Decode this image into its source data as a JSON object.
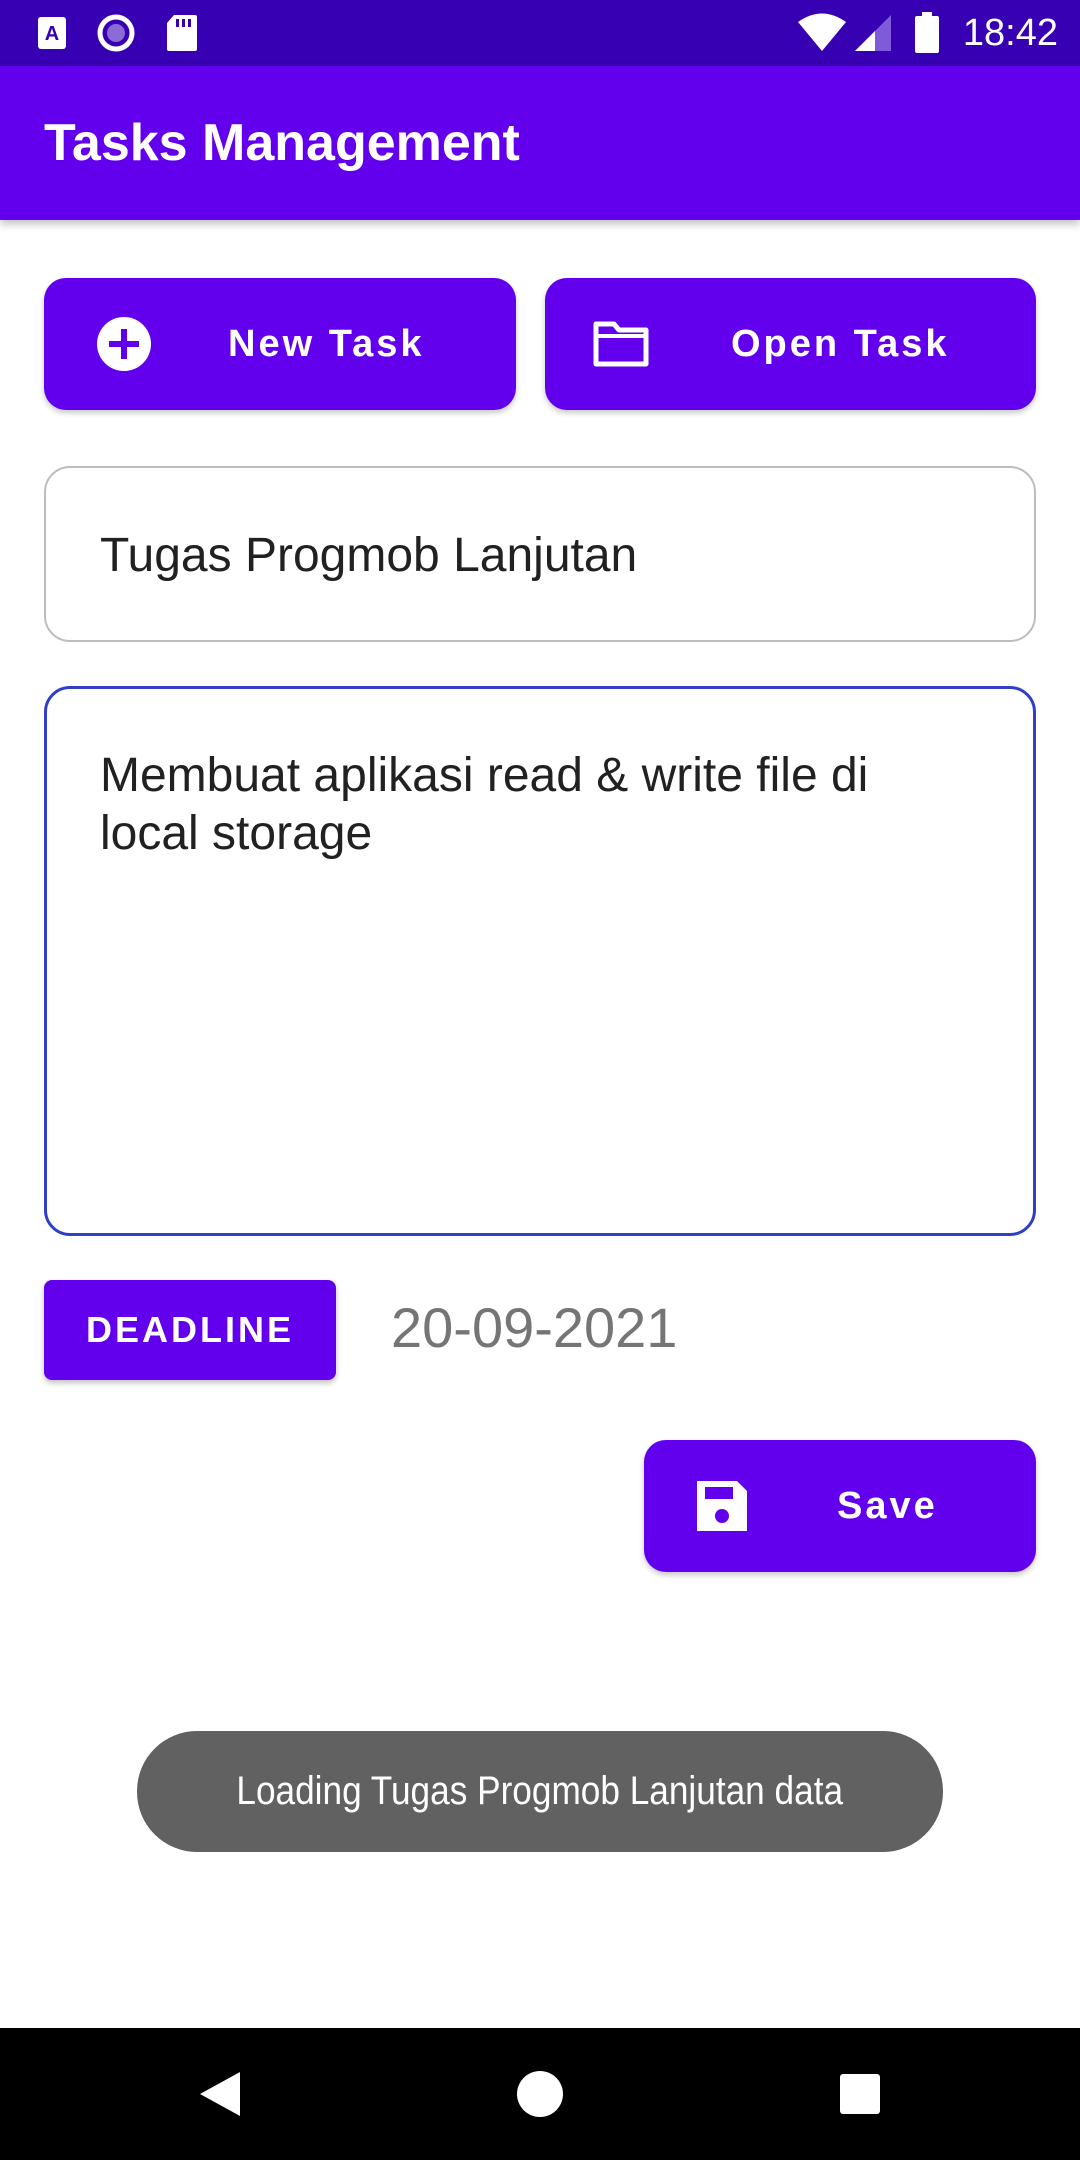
{
  "status_bar": {
    "time": "18:42",
    "icons": [
      "app-a-icon",
      "circle-notification-icon",
      "sd-card-icon",
      "wifi-icon",
      "cell-signal-icon",
      "battery-icon"
    ]
  },
  "app_bar": {
    "title": "Tasks Management"
  },
  "toolbar": {
    "new_task_label": "New Task",
    "new_task_icon": "add-circle-icon",
    "open_task_label": "Open Task",
    "open_task_icon": "folder-icon"
  },
  "form": {
    "title_value": "Tugas Progmob Lanjutan",
    "description_value": "Membuat aplikasi read & write file di local storage",
    "deadline_label": "DEADLINE",
    "deadline_date": "20-09-2021",
    "save_label": "Save",
    "save_icon": "save-icon"
  },
  "toast": {
    "message": "Loading Tugas Progmob Lanjutan data"
  },
  "nav_bar": {
    "buttons": [
      "back-icon",
      "home-icon",
      "recents-icon"
    ]
  },
  "colors": {
    "status_bar": "#3700b3",
    "primary": "#6200ee",
    "focused_border": "#2f3fc7",
    "toast_bg": "#616161"
  }
}
